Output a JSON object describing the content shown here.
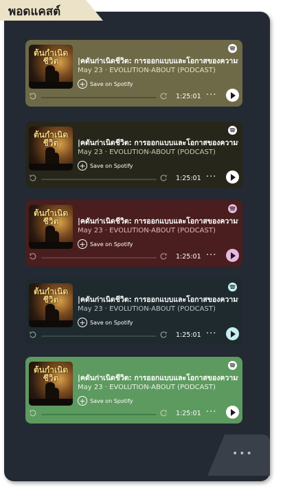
{
  "section": {
    "title": "พอดแคสต์"
  },
  "embeds": [
    {
      "theme": {
        "bg": "#6e6a47",
        "meta": "#e8e2c6",
        "track": "#50503a",
        "play_bg": "#ffffff",
        "spotify_bg": "#ffffff"
      }
    },
    {
      "theme": {
        "bg": "#26261a",
        "meta": "#cfcab0",
        "track": "#4b4a3a",
        "play_bg": "#ffffff",
        "spotify_bg": "#ffffff"
      }
    },
    {
      "theme": {
        "bg": "#4a1e1e",
        "meta": "#e3b8ba",
        "track": "#6a3a3a",
        "play_bg": "#e7b8e0",
        "spotify_bg": "#e7b8e0"
      }
    },
    {
      "theme": {
        "bg": "#1e2a2e",
        "meta": "#b7c6cc",
        "track": "#3a464a",
        "play_bg": "#c6eef0",
        "spotify_bg": "#c6eef0"
      }
    },
    {
      "theme": {
        "bg": "#5d9a5f",
        "meta": "#e8f5e6",
        "track": "#3f7f47",
        "play_bg": "#ffffff",
        "spotify_bg": "#ffffff"
      }
    }
  ],
  "episode": {
    "title": "|คดันก่าเนิดชีวิต: การออกแบบและโอกาสของความบังเอิญ",
    "meta": "May 23 · EVOLUTION-ABOUT (PODCAST)",
    "save_label": "Save on Spotify",
    "duration": "1:25:01",
    "art_title": "ต้นกำเนิดชีวิต"
  },
  "icons": {
    "spotify": "spotify-icon",
    "skip_back": "skip-back-15-icon",
    "skip_forward": "skip-forward-15-icon",
    "more": "more-horizontal-icon",
    "play": "play-icon",
    "save": "plus-circle-icon"
  },
  "more_tab": {
    "label": "•••"
  }
}
